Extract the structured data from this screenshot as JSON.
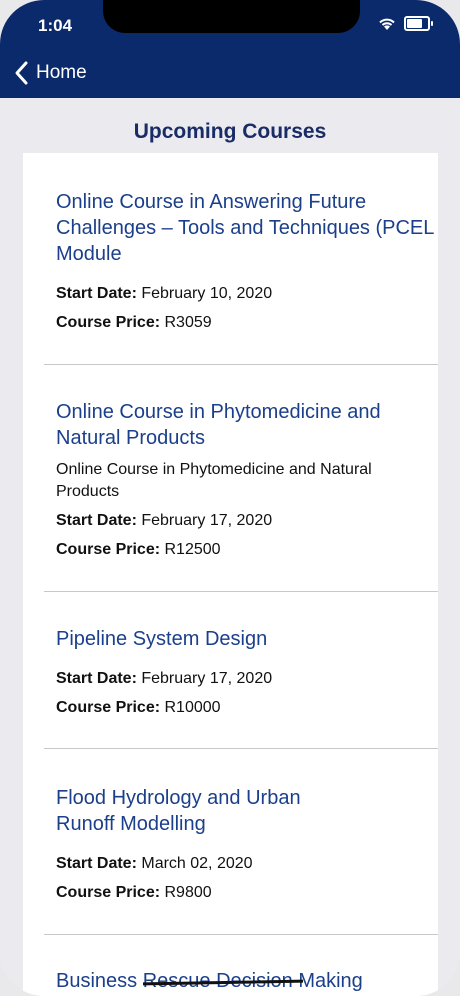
{
  "status": {
    "time": "1:04"
  },
  "nav": {
    "back_label": "Home"
  },
  "page": {
    "title": "Upcoming Courses"
  },
  "labels": {
    "start_date": "Start Date:",
    "price": "Course Price:"
  },
  "courses": [
    {
      "title": "Online Course in Answering Future Challenges – Tools and Techniques (PCEL Module",
      "start_date": "February 10, 2020",
      "price": "R3059"
    },
    {
      "title": "Online Course in Phytomedicine and Natural Products",
      "description": "Online Course in Phytomedicine and Natural Products",
      "start_date": "February 17, 2020",
      "price": "R12500"
    },
    {
      "title": "Pipeline System Design",
      "start_date": "February 17, 2020",
      "price": "R10000"
    },
    {
      "title": "Flood Hydrology and Urban Runoff Modelling",
      "start_date": "March 02, 2020",
      "price": "R9800"
    },
    {
      "title": "Business Rescue Decision Making"
    }
  ],
  "colors": {
    "header": "#0b2a6b",
    "title": "#1a2c66",
    "link": "#1b3f8b",
    "background": "#ebebef"
  }
}
